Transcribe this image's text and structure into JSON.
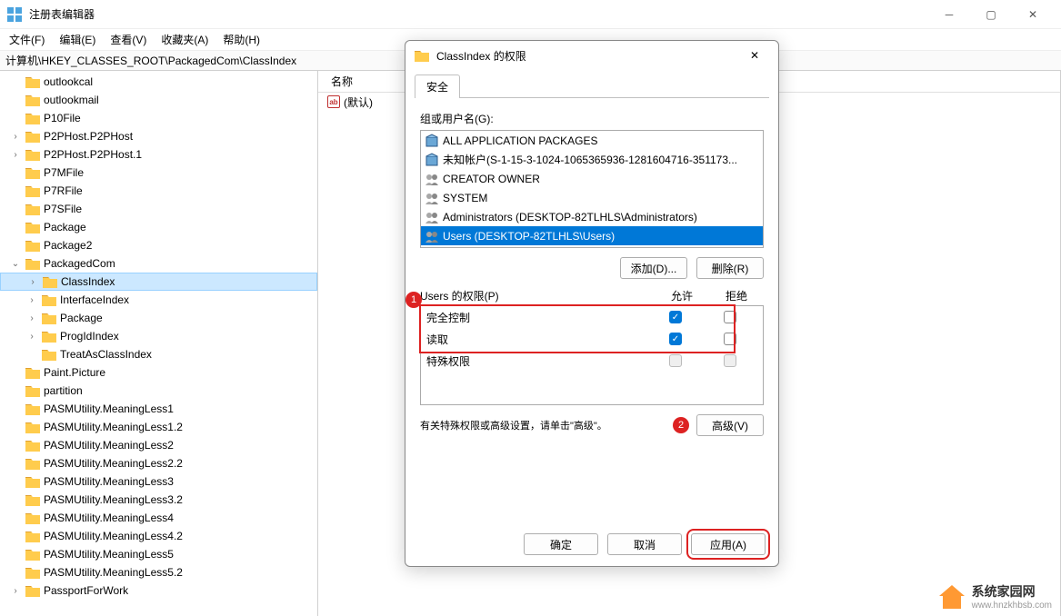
{
  "window": {
    "title": "注册表编辑器",
    "address": "计算机\\HKEY_CLASSES_ROOT\\PackagedCom\\ClassIndex"
  },
  "menu": {
    "file": "文件(F)",
    "edit": "编辑(E)",
    "view": "查看(V)",
    "favorites": "收藏夹(A)",
    "help": "帮助(H)"
  },
  "tree": {
    "items": [
      {
        "d": 2,
        "exp": "",
        "label": "outlookcal"
      },
      {
        "d": 2,
        "exp": "",
        "label": "outlookmail"
      },
      {
        "d": 2,
        "exp": "",
        "label": "P10File"
      },
      {
        "d": 2,
        "exp": ">",
        "label": "P2PHost.P2PHost"
      },
      {
        "d": 2,
        "exp": ">",
        "label": "P2PHost.P2PHost.1"
      },
      {
        "d": 2,
        "exp": "",
        "label": "P7MFile"
      },
      {
        "d": 2,
        "exp": "",
        "label": "P7RFile"
      },
      {
        "d": 2,
        "exp": "",
        "label": "P7SFile"
      },
      {
        "d": 2,
        "exp": "",
        "label": "Package"
      },
      {
        "d": 2,
        "exp": "",
        "label": "Package2"
      },
      {
        "d": 2,
        "exp": "v",
        "label": "PackagedCom"
      },
      {
        "d": 3,
        "exp": ">",
        "label": "ClassIndex",
        "sel": true
      },
      {
        "d": 3,
        "exp": ">",
        "label": "InterfaceIndex"
      },
      {
        "d": 3,
        "exp": ">",
        "label": "Package"
      },
      {
        "d": 3,
        "exp": ">",
        "label": "ProgIdIndex"
      },
      {
        "d": 3,
        "exp": "",
        "label": "TreatAsClassIndex",
        "last": true
      },
      {
        "d": 2,
        "exp": "",
        "label": "Paint.Picture"
      },
      {
        "d": 2,
        "exp": "",
        "label": "partition"
      },
      {
        "d": 2,
        "exp": "",
        "label": "PASMUtility.MeaningLess1"
      },
      {
        "d": 2,
        "exp": "",
        "label": "PASMUtility.MeaningLess1.2"
      },
      {
        "d": 2,
        "exp": "",
        "label": "PASMUtility.MeaningLess2"
      },
      {
        "d": 2,
        "exp": "",
        "label": "PASMUtility.MeaningLess2.2"
      },
      {
        "d": 2,
        "exp": "",
        "label": "PASMUtility.MeaningLess3"
      },
      {
        "d": 2,
        "exp": "",
        "label": "PASMUtility.MeaningLess3.2"
      },
      {
        "d": 2,
        "exp": "",
        "label": "PASMUtility.MeaningLess4"
      },
      {
        "d": 2,
        "exp": "",
        "label": "PASMUtility.MeaningLess4.2"
      },
      {
        "d": 2,
        "exp": "",
        "label": "PASMUtility.MeaningLess5"
      },
      {
        "d": 2,
        "exp": "",
        "label": "PASMUtility.MeaningLess5.2"
      },
      {
        "d": 2,
        "exp": ">",
        "label": "PassportForWork"
      }
    ]
  },
  "list": {
    "header_name": "名称",
    "default_name": "(默认)"
  },
  "dialog": {
    "title": "ClassIndex 的权限",
    "tab_security": "安全",
    "group_label": "组或用户名(G):",
    "users": [
      {
        "icon": "pkg",
        "label": "ALL APPLICATION PACKAGES"
      },
      {
        "icon": "pkg",
        "label": "未知帐户(S-1-15-3-1024-1065365936-1281604716-351173..."
      },
      {
        "icon": "grp",
        "label": "CREATOR OWNER"
      },
      {
        "icon": "grp",
        "label": "SYSTEM"
      },
      {
        "icon": "grp",
        "label": "Administrators (DESKTOP-82TLHLS\\Administrators)"
      },
      {
        "icon": "grp",
        "label": "Users (DESKTOP-82TLHLS\\Users)",
        "sel": true
      }
    ],
    "add_btn": "添加(D)...",
    "remove_btn": "删除(R)",
    "perm_label": "Users 的权限(P)",
    "allow": "允许",
    "deny": "拒绝",
    "perms": [
      {
        "name": "完全控制",
        "allow": true,
        "deny": false
      },
      {
        "name": "读取",
        "allow": true,
        "deny": false
      },
      {
        "name": "特殊权限",
        "allow": false,
        "deny": false,
        "disabled": true
      }
    ],
    "adv_text": "有关特殊权限或高级设置，请单击\"高级\"。",
    "adv_btn": "高级(V)",
    "ok": "确定",
    "cancel": "取消",
    "apply": "应用(A)"
  },
  "watermark": {
    "line1": "系统家园网",
    "line2": "www.hnzkhbsb.com"
  }
}
